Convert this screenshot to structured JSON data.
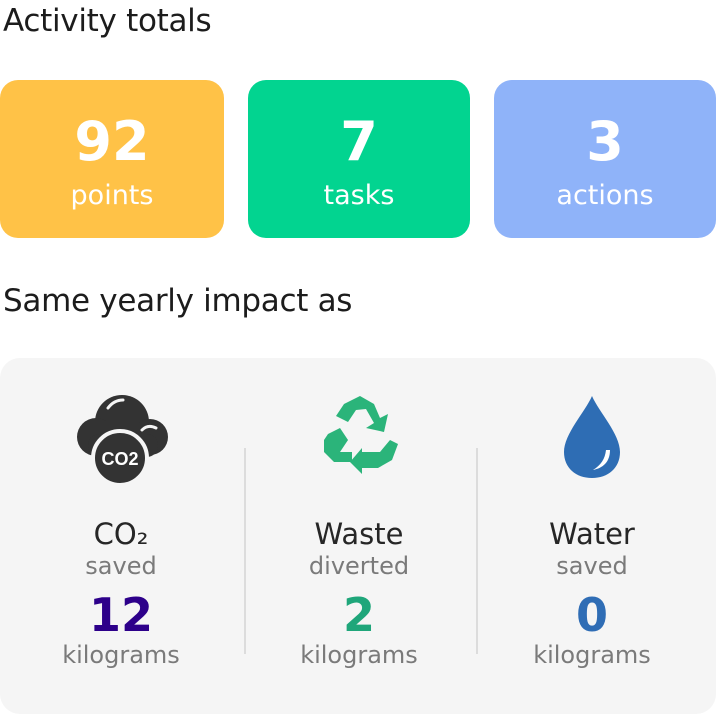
{
  "activity": {
    "heading": "Activity totals",
    "tiles": [
      {
        "value": "92",
        "label": "points",
        "color": "#FFC247"
      },
      {
        "value": "7",
        "label": "tasks",
        "color": "#02D490"
      },
      {
        "value": "3",
        "label": "actions",
        "color": "#8FB3F9"
      }
    ]
  },
  "impact": {
    "heading": "Same yearly impact as",
    "items": [
      {
        "icon": "co2-cloud-icon",
        "icon_text": "CO2",
        "title": "CO₂",
        "subtitle": "saved",
        "value": "12",
        "unit": "kilograms",
        "value_color": "#2D008A"
      },
      {
        "icon": "recycle-icon",
        "title": "Waste",
        "subtitle": "diverted",
        "value": "2",
        "unit": "kilograms",
        "value_color": "#1FA67A"
      },
      {
        "icon": "water-drop-icon",
        "title": "Water",
        "subtitle": "saved",
        "value": "0",
        "unit": "kilograms",
        "value_color": "#2F6DB5"
      }
    ]
  }
}
